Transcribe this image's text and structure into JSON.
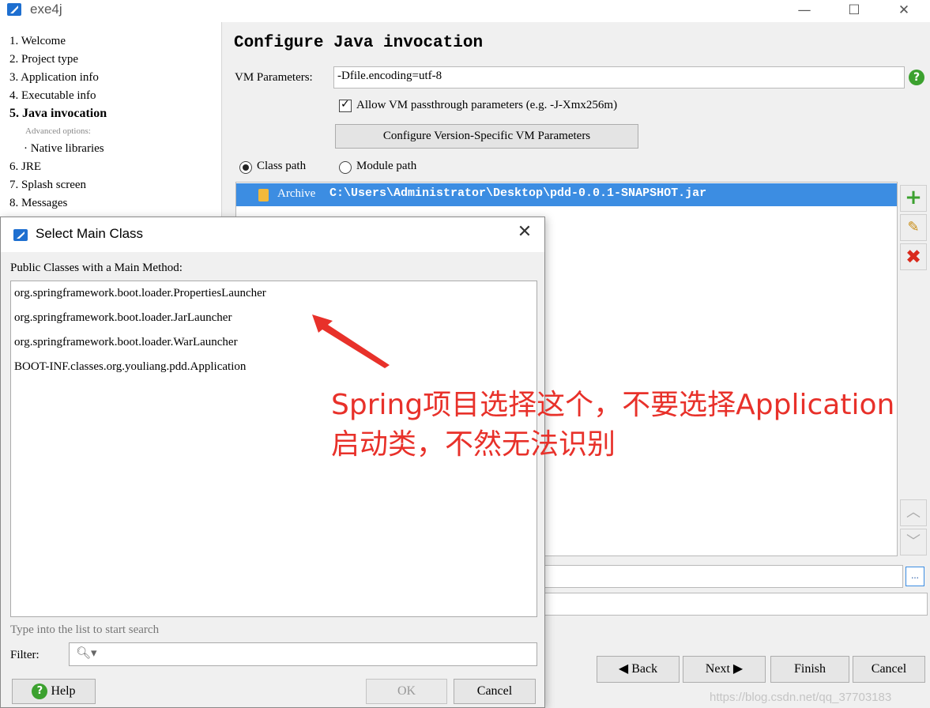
{
  "window": {
    "title": "exe4j",
    "controls": [
      "—",
      "☐",
      "✕"
    ]
  },
  "steps": [
    {
      "label": "1. Welcome"
    },
    {
      "label": "2. Project type"
    },
    {
      "label": "3. Application info"
    },
    {
      "label": "4. Executable info"
    },
    {
      "label": "5. Java invocation",
      "active": true
    },
    {
      "label": "Advanced options:",
      "sub": true
    },
    {
      "label": "· Native libraries"
    },
    {
      "label": "6. JRE"
    },
    {
      "label": "7. Splash screen"
    },
    {
      "label": "8. Messages"
    }
  ],
  "panel": {
    "title": "Configure Java invocation",
    "vm_label": "VM Parameters:",
    "vm_value": "-Dfile.encoding=utf-8",
    "passthrough_label": "Allow VM passthrough parameters (e.g. -J-Xmx256m)",
    "passthrough_checked": true,
    "version_button": "Configure Version-Specific VM Parameters",
    "radio_classpath": "Class path",
    "radio_modulepath": "Module path",
    "selected_radio": "Class path",
    "classpath_entry": {
      "kind": "Archive",
      "path": "C:\\Users\\Administrator\\Desktop\\pdd-0.0.1-SNAPSHOT.jar"
    },
    "browse_button": "...",
    "side_buttons": [
      "add-icon",
      "edit-icon",
      "remove-icon",
      "move-up-icon",
      "move-down-icon"
    ]
  },
  "nav": {
    "back": "Back",
    "next": "Next",
    "finish": "Finish",
    "cancel": "Cancel"
  },
  "dialog": {
    "title": "Select Main Class",
    "close": "✕",
    "heading": "Public Classes with a Main Method:",
    "classes": [
      "org.springframework.boot.loader.PropertiesLauncher",
      "org.springframework.boot.loader.JarLauncher",
      "org.springframework.boot.loader.WarLauncher",
      "BOOT-INF.classes.org.youliang.pdd.Application"
    ],
    "hint": "Type into the list to start search",
    "filter_label": "Filter:",
    "filter_value": "",
    "help_button": "Help",
    "ok_button": "OK",
    "cancel_button": "Cancel"
  },
  "annotation": {
    "line1": "Spring项目选择这个，不要选择Application",
    "line2": "启动类，不然无法识别",
    "color": "#e8312a"
  },
  "watermark": "https://blog.csdn.net/qq_37703183"
}
